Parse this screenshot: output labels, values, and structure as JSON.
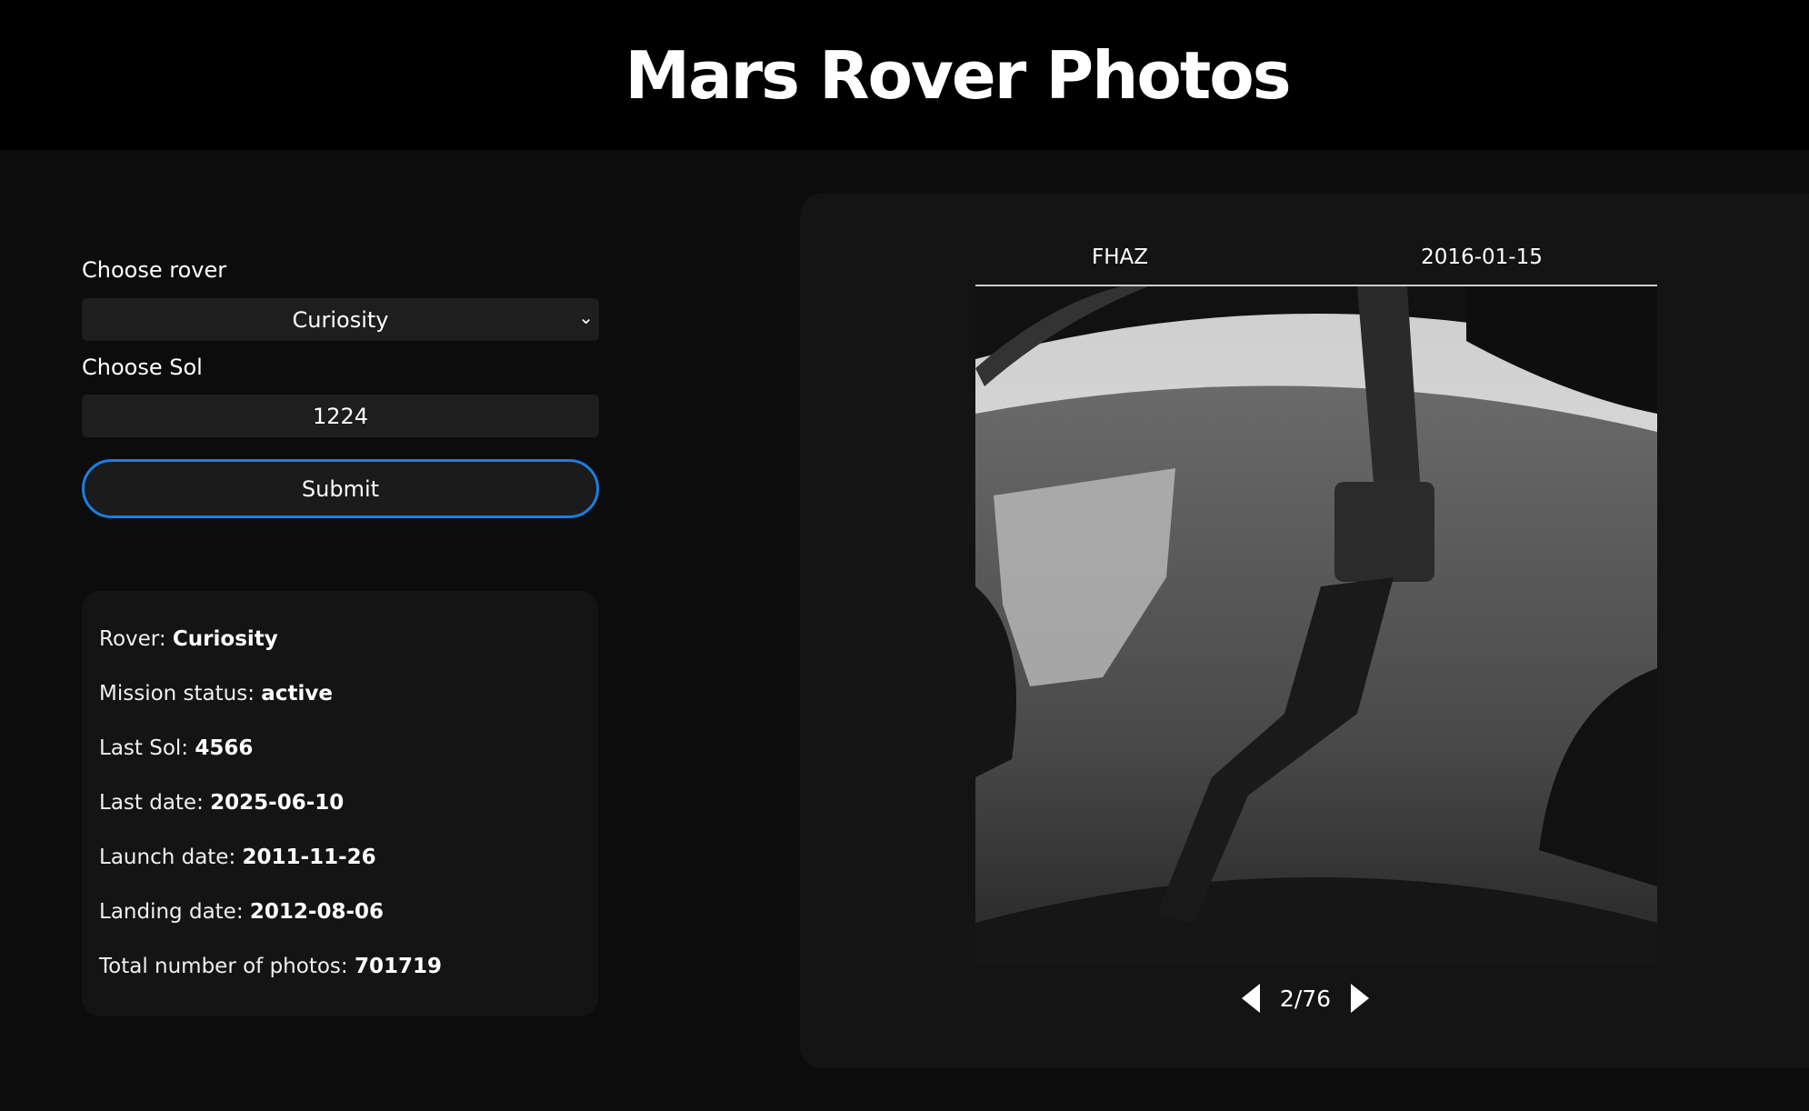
{
  "header": {
    "title": "Mars Rover Photos"
  },
  "form": {
    "rover_label": "Choose rover",
    "rover_value": "Curiosity",
    "sol_label": "Choose Sol",
    "sol_value": "1224",
    "submit_label": "Submit"
  },
  "info": [
    {
      "label": "Rover: ",
      "value": "Curiosity"
    },
    {
      "label": "Mission status: ",
      "value": "active"
    },
    {
      "label": "Last Sol: ",
      "value": "4566"
    },
    {
      "label": "Last date: ",
      "value": "2025-06-10"
    },
    {
      "label": "Launch date: ",
      "value": "2011-11-26"
    },
    {
      "label": "Landing date: ",
      "value": "2012-08-06"
    },
    {
      "label": "Total number of photos: ",
      "value": "701719"
    }
  ],
  "photo": {
    "camera": "FHAZ",
    "earth_date": "2016-01-15",
    "pager": "2/76",
    "current": 2,
    "total": 76
  },
  "colors": {
    "accent": "#1a7fe0",
    "panel": "#141414",
    "background": "#0c0c0c"
  }
}
